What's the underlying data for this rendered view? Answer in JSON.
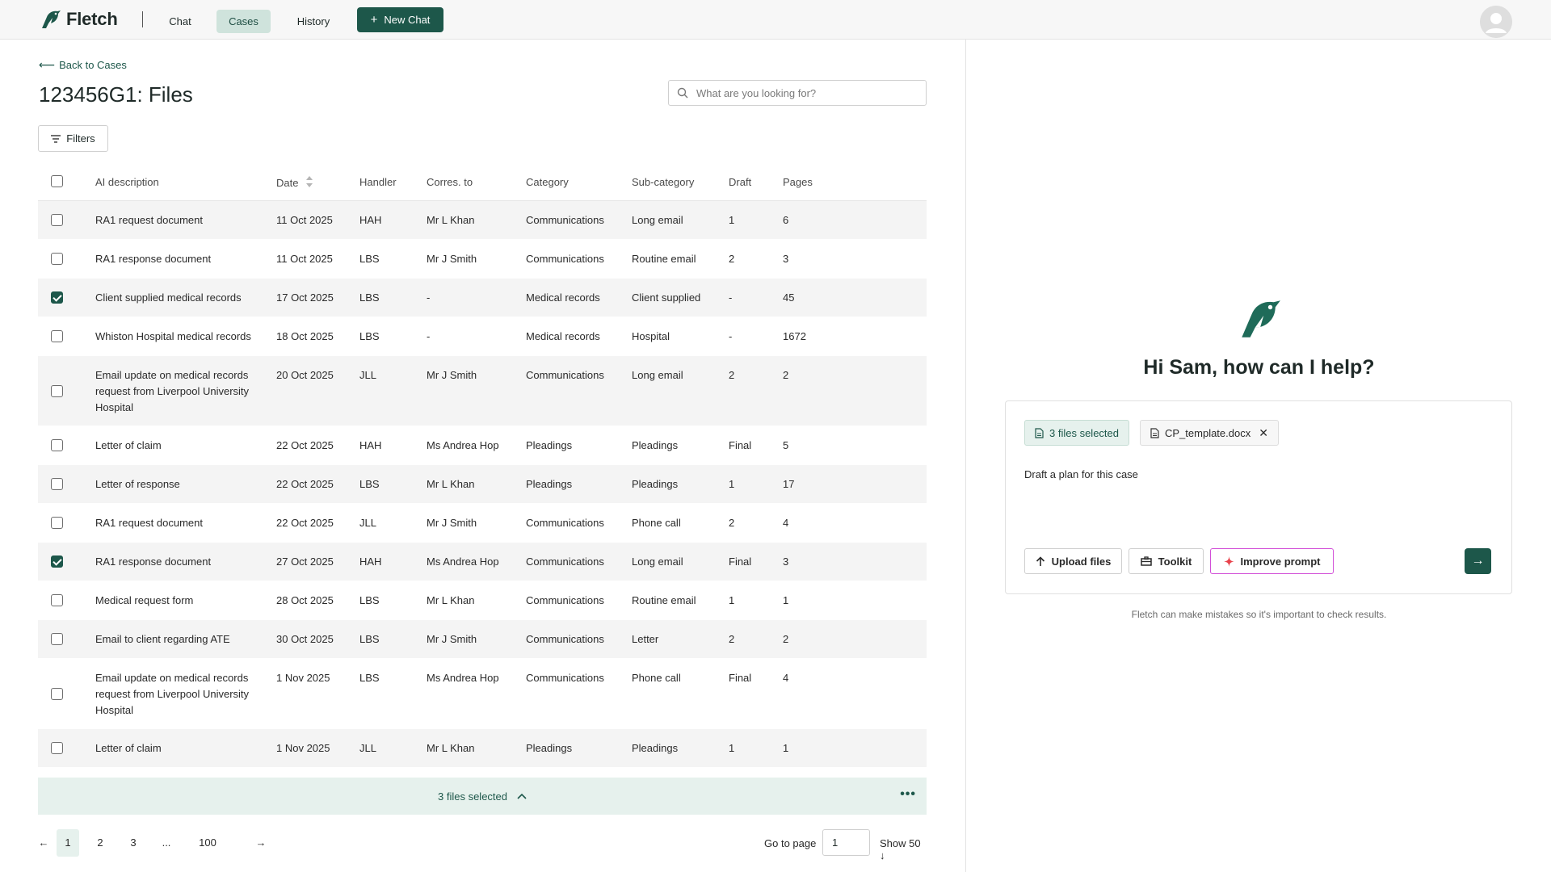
{
  "app": {
    "brand": "Fletch",
    "nav": {
      "chat": "Chat",
      "cases": "Cases",
      "history": "History",
      "new_chat": "New Chat"
    },
    "colors": {
      "accent": "#1d574a",
      "accent_light": "#e6f1ed",
      "improve_border": "#d24fd8",
      "improve_icon": "#e8424b"
    }
  },
  "files_page": {
    "back_label": "Back to Cases",
    "title": "123456G1: Files",
    "search_placeholder": "What are you looking for?",
    "filters_label": "Filters",
    "columns": [
      "AI description",
      "Date",
      "Handler",
      "Corres. to",
      "Category",
      "Sub-category",
      "Draft",
      "Pages"
    ],
    "rows": [
      {
        "checked": false,
        "desc": "RA1 request document",
        "date": "11 Oct 2025",
        "handler": "HAH",
        "corres": "Mr L Khan",
        "category": "Communications",
        "sub": "Long email",
        "draft": "1",
        "pages": "6"
      },
      {
        "checked": false,
        "desc": "RA1 response document",
        "date": "11 Oct 2025",
        "handler": "LBS",
        "corres": "Mr J Smith",
        "category": "Communications",
        "sub": "Routine email",
        "draft": "2",
        "pages": "3"
      },
      {
        "checked": true,
        "desc": "Client supplied medical records",
        "date": "17 Oct 2025",
        "handler": "LBS",
        "corres": "-",
        "category": "Medical records",
        "sub": "Client supplied",
        "draft": "-",
        "pages": "45"
      },
      {
        "checked": false,
        "desc": "Whiston Hospital medical records",
        "date": "18 Oct 2025",
        "handler": "LBS",
        "corres": "-",
        "category": "Medical records",
        "sub": "Hospital",
        "draft": "-",
        "pages": "1672"
      },
      {
        "checked": false,
        "desc": "Email update on medical records request from Liverpool University Hospital",
        "date": "20 Oct 2025",
        "handler": "JLL",
        "corres": "Mr J Smith",
        "category": "Communications",
        "sub": "Long email",
        "draft": "2",
        "pages": "2"
      },
      {
        "checked": false,
        "desc": "Letter of claim",
        "date": "22 Oct 2025",
        "handler": "HAH",
        "corres": "Ms Andrea Hop",
        "category": "Pleadings",
        "sub": "Pleadings",
        "draft": "Final",
        "pages": "5"
      },
      {
        "checked": false,
        "desc": "Letter of response",
        "date": "22 Oct 2025",
        "handler": "LBS",
        "corres": "Mr L Khan",
        "category": "Pleadings",
        "sub": "Pleadings",
        "draft": "1",
        "pages": "17"
      },
      {
        "checked": false,
        "desc": "RA1 request document",
        "date": "22 Oct 2025",
        "handler": "JLL",
        "corres": "Mr J Smith",
        "category": "Communications",
        "sub": "Phone call",
        "draft": "2",
        "pages": "4"
      },
      {
        "checked": true,
        "desc": "RA1 response document",
        "date": "27 Oct 2025",
        "handler": "HAH",
        "corres": "Ms Andrea Hop",
        "category": "Communications",
        "sub": "Long email",
        "draft": "Final",
        "pages": "3"
      },
      {
        "checked": false,
        "desc": "Medical request form",
        "date": "28 Oct 2025",
        "handler": "LBS",
        "corres": "Mr L Khan",
        "category": "Communications",
        "sub": "Routine email",
        "draft": "1",
        "pages": "1"
      },
      {
        "checked": false,
        "desc": "Email to client regarding ATE",
        "date": "30 Oct 2025",
        "handler": "LBS",
        "corres": "Mr J Smith",
        "category": "Communications",
        "sub": "Letter",
        "draft": "2",
        "pages": "2"
      },
      {
        "checked": false,
        "desc": "Email update on medical records request from Liverpool University Hospital",
        "date": "1 Nov 2025",
        "handler": "LBS",
        "corres": "Ms Andrea Hop",
        "category": "Communications",
        "sub": "Phone call",
        "draft": "Final",
        "pages": "4"
      },
      {
        "checked": false,
        "desc": "Letter of claim",
        "date": "1 Nov 2025",
        "handler": "JLL",
        "corres": "Mr L Khan",
        "category": "Pleadings",
        "sub": "Pleadings",
        "draft": "1",
        "pages": "1"
      }
    ],
    "selection_label": "3 files selected",
    "more_label": "•••",
    "pagination": {
      "prev": "←",
      "next": "→",
      "pages": [
        "1",
        "2",
        "3",
        "...",
        "100"
      ],
      "active": "1",
      "goto_label": "Go to page",
      "goto_value": "1",
      "show_label": "Show 50 ↓"
    }
  },
  "assistant": {
    "greeting": "Hi Sam, how can I help?",
    "files_chip": "3 files selected",
    "template_chip": "CP_template.docx",
    "prompt": "Draft a plan for this case",
    "upload_label": "Upload files",
    "toolkit_label": "Toolkit",
    "improve_label": "Improve prompt",
    "send_label": "→",
    "disclaimer": "Fletch can make mistakes so it's important to check results."
  }
}
